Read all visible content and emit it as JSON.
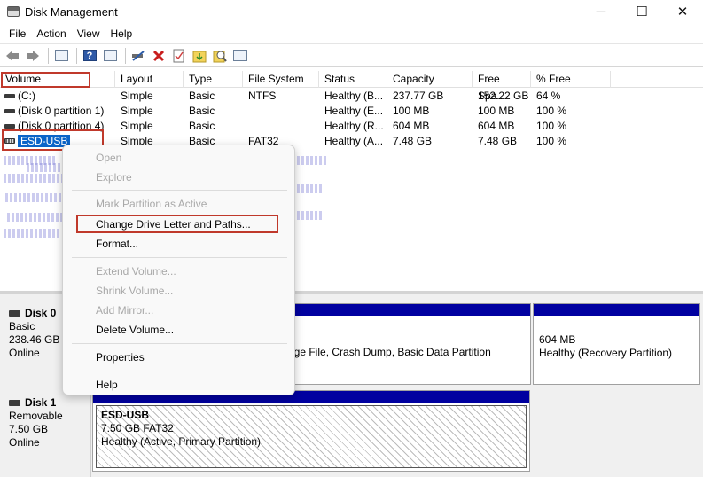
{
  "window": {
    "title": "Disk Management",
    "controls": {
      "minimize": "─",
      "maximize": "☐",
      "close": "✕"
    }
  },
  "menu": [
    "File",
    "Action",
    "View",
    "Help"
  ],
  "toolbar_icons": [
    "back-arrow-icon",
    "forward-arrow-icon",
    "list-view-icon",
    "help-icon",
    "console-tree-icon",
    "connect-icon",
    "delete-icon",
    "check-icon",
    "import-icon",
    "search-icon",
    "properties-icon"
  ],
  "volume_list": {
    "columns": [
      "Volume",
      "Layout",
      "Type",
      "File System",
      "Status",
      "Capacity",
      "Free Spa...",
      "% Free"
    ],
    "rows": [
      [
        "(C:)",
        "Simple",
        "Basic",
        "NTFS",
        "Healthy (B...",
        "237.77 GB",
        "152.22 GB",
        "64 %"
      ],
      [
        "(Disk 0 partition 1)",
        "Simple",
        "Basic",
        "",
        "Healthy (E...",
        "100 MB",
        "100 MB",
        "100 %"
      ],
      [
        "(Disk 0 partition 4)",
        "Simple",
        "Basic",
        "",
        "Healthy (R...",
        "604 MB",
        "604 MB",
        "100 %"
      ],
      [
        "ESD-USB",
        "Simple",
        "Basic",
        "FAT32",
        "Healthy (A...",
        "7.48 GB",
        "7.48 GB",
        "100 %"
      ]
    ]
  },
  "context_menu": {
    "items": [
      {
        "label": "Open",
        "disabled": true
      },
      {
        "label": "Explore",
        "disabled": true
      },
      {
        "label": "Mark Partition as Active",
        "disabled": true
      },
      {
        "label": "Change Drive Letter and Paths...",
        "disabled": false,
        "highlighted": true
      },
      {
        "label": "Format...",
        "disabled": false
      },
      {
        "label": "Extend Volume...",
        "disabled": true
      },
      {
        "label": "Shrink Volume...",
        "disabled": true
      },
      {
        "label": "Add Mirror...",
        "disabled": true
      },
      {
        "label": "Delete Volume...",
        "disabled": false
      },
      {
        "label": "Properties",
        "disabled": false
      },
      {
        "label": "Help",
        "disabled": false
      }
    ]
  },
  "disks": [
    {
      "name": "Disk 0",
      "type": "Basic",
      "size": "238.46 GB",
      "state": "Online",
      "partitions": [
        {
          "line1": "",
          "line2": "age File, Crash Dump, Basic Data Partition"
        },
        {
          "line1": "604 MB",
          "line2": "Healthy (Recovery Partition)"
        }
      ]
    },
    {
      "name": "Disk 1",
      "type": "Removable",
      "size": "7.50 GB",
      "state": "Online",
      "partitions": [
        {
          "name": "ESD-USB",
          "fs": "7.50 GB FAT32",
          "status": "Healthy (Active, Primary Partition)"
        }
      ]
    }
  ],
  "colors": {
    "partition_bar": "#0000a0",
    "selection": "#0a64c8",
    "highlight_box": "#c0392b"
  }
}
